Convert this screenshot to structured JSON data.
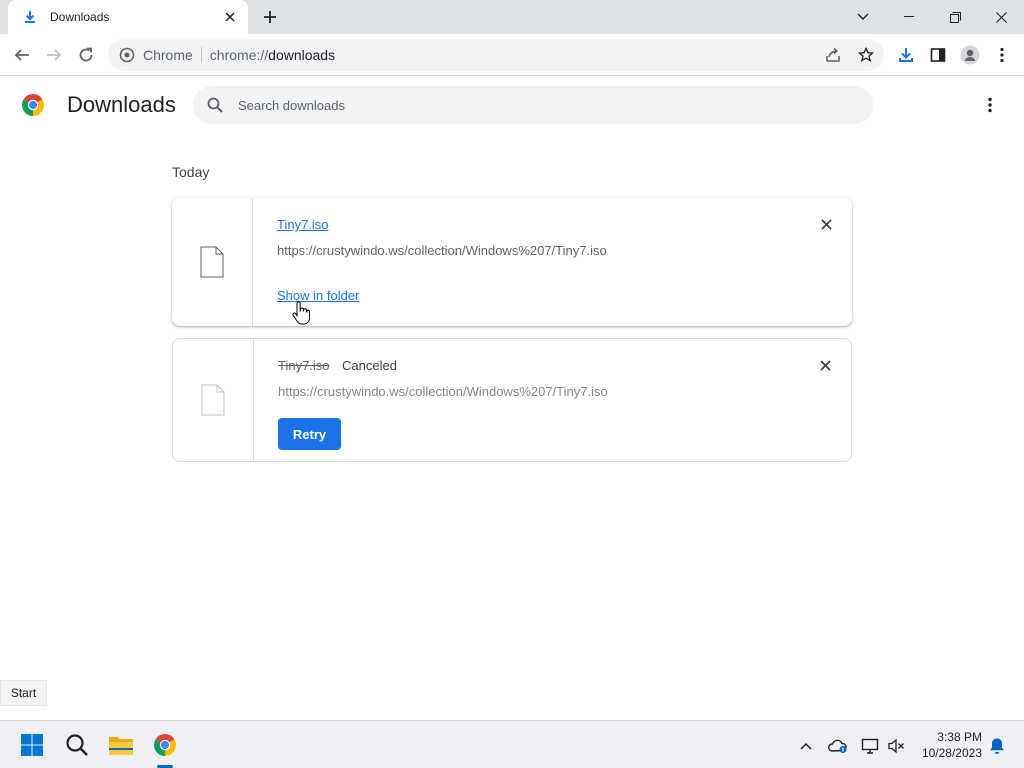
{
  "browser": {
    "tab_title": "Downloads",
    "omnibox_chip": "Chrome",
    "url_scheme": "chrome://",
    "url_path": "downloads"
  },
  "page": {
    "title": "Downloads",
    "search_placeholder": "Search downloads"
  },
  "downloads": {
    "section_label": "Today",
    "items": [
      {
        "file_name": "Tiny7.iso",
        "url": "https://crustywindo.ws/collection/Windows%207/Tiny7.iso",
        "action_label": "Show in folder"
      },
      {
        "file_name": "Tiny7.iso",
        "status": "Canceled",
        "url": "https://crustywindo.ws/collection/Windows%207/Tiny7.iso",
        "action_label": "Retry"
      }
    ]
  },
  "taskbar": {
    "start_tooltip": "Start",
    "time": "3:38 PM",
    "date": "10/28/2023"
  },
  "colors": {
    "accent": "#1a73e8",
    "tabstrip": "#dee1e6",
    "omnibox": "#f1f3f4"
  }
}
